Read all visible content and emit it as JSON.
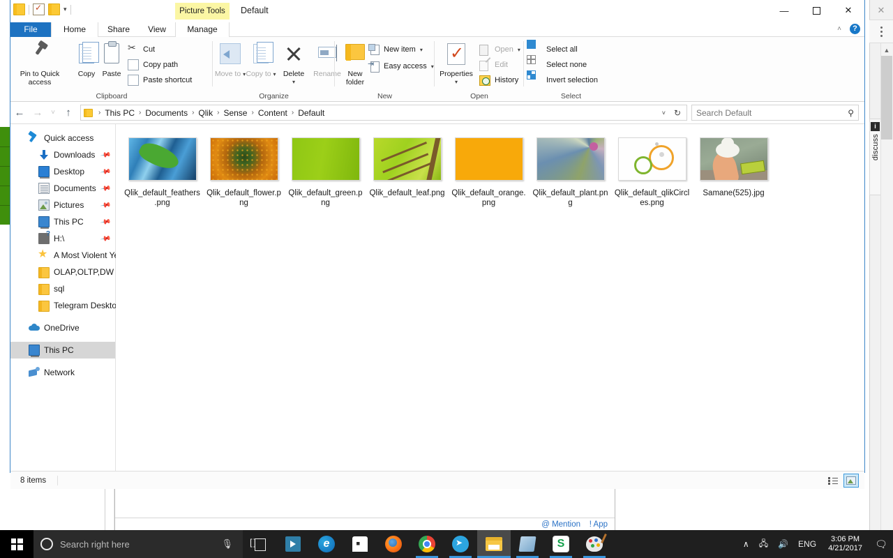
{
  "window": {
    "title": "Default",
    "contextual_tab_group": "Picture Tools",
    "quick_access": [
      "folder-icon",
      "properties-check-icon",
      "folder-icon",
      "dropdown-caret"
    ],
    "controls": {
      "minimize": "—",
      "maximize": "☐",
      "close": "✕"
    },
    "ribbon_collapse": "˄",
    "help": "?"
  },
  "tabs": [
    {
      "label": "File",
      "active": false,
      "highlight": true
    },
    {
      "label": "Home",
      "active": true
    },
    {
      "label": "Share",
      "active": false
    },
    {
      "label": "View",
      "active": false
    },
    {
      "label": "Manage",
      "active": false
    }
  ],
  "ribbon": {
    "groups": [
      {
        "name": "Clipboard",
        "big_buttons": [
          {
            "label": "Pin to Quick access",
            "icon": "pin-icon",
            "dim": false
          },
          {
            "label": "Copy",
            "icon": "copy-icon",
            "dim": false
          },
          {
            "label": "Paste",
            "icon": "paste-icon",
            "dim": false
          }
        ],
        "small_buttons": [
          {
            "label": "Cut",
            "icon": "scissors-icon",
            "dim": false
          },
          {
            "label": "Copy path",
            "icon": "copy-path-icon",
            "dim": false
          },
          {
            "label": "Paste shortcut",
            "icon": "paste-shortcut-icon",
            "dim": false
          }
        ]
      },
      {
        "name": "Organize",
        "big_buttons": [
          {
            "label": "Move to",
            "icon": "move-to-icon",
            "dim": true,
            "caret": true
          },
          {
            "label": "Copy to",
            "icon": "copy-to-icon",
            "dim": true,
            "caret": true
          },
          {
            "label": "Delete",
            "icon": "delete-x-icon",
            "dim": false,
            "caret": true
          },
          {
            "label": "Rename",
            "icon": "rename-icon",
            "dim": true
          }
        ],
        "small_buttons": []
      },
      {
        "name": "New",
        "big_buttons": [
          {
            "label": "New folder",
            "icon": "new-folder-icon",
            "dim": false
          }
        ],
        "small_buttons": [
          {
            "label": "New item",
            "icon": "new-item-icon",
            "dim": false,
            "caret": true
          },
          {
            "label": "Easy access",
            "icon": "easy-access-icon",
            "dim": false,
            "caret": true
          }
        ]
      },
      {
        "name": "Open",
        "big_buttons": [
          {
            "label": "Properties",
            "icon": "properties-icon",
            "dim": false,
            "caret": true
          }
        ],
        "small_buttons": [
          {
            "label": "Open",
            "icon": "open-icon",
            "dim": true,
            "caret": true
          },
          {
            "label": "Edit",
            "icon": "edit-icon",
            "dim": true
          },
          {
            "label": "History",
            "icon": "history-icon",
            "dim": false
          }
        ]
      },
      {
        "name": "Select",
        "big_buttons": [],
        "small_buttons": [
          {
            "label": "Select all",
            "icon": "select-all-icon",
            "dim": false
          },
          {
            "label": "Select none",
            "icon": "select-none-icon",
            "dim": false
          },
          {
            "label": "Invert selection",
            "icon": "invert-selection-icon",
            "dim": false
          }
        ]
      }
    ]
  },
  "address": {
    "back": "←",
    "forward": "→",
    "recent": "˅",
    "up": "↑",
    "breadcrumbs": [
      "This PC",
      "Documents",
      "Qlik",
      "Sense",
      "Content",
      "Default"
    ],
    "separator": "›",
    "dropdown": "˅",
    "refresh": "↻"
  },
  "search": {
    "placeholder": "Search Default",
    "value": "",
    "icon": "search-icon"
  },
  "sidebar": {
    "items": [
      {
        "label": "Quick access",
        "icon": "quick-access-star-icon",
        "level": 1,
        "pinned": false,
        "selected": false
      },
      {
        "label": "Downloads",
        "icon": "downloads-icon",
        "level": 2,
        "pinned": true,
        "selected": false
      },
      {
        "label": "Desktop",
        "icon": "desktop-icon",
        "level": 2,
        "pinned": true,
        "selected": false
      },
      {
        "label": "Documents",
        "icon": "documents-icon",
        "level": 2,
        "pinned": true,
        "selected": false
      },
      {
        "label": "Pictures",
        "icon": "pictures-icon",
        "level": 2,
        "pinned": true,
        "selected": false
      },
      {
        "label": "This PC",
        "icon": "this-pc-icon",
        "level": 2,
        "pinned": true,
        "selected": false
      },
      {
        "label": "H:\\",
        "icon": "drive-icon",
        "level": 2,
        "pinned": true,
        "selected": false
      },
      {
        "label": "A Most Violent Year",
        "icon": "star-folder-icon",
        "level": 2,
        "pinned": false,
        "selected": false
      },
      {
        "label": "OLAP,OLTP,DW",
        "icon": "folder-icon",
        "level": 2,
        "pinned": false,
        "selected": false
      },
      {
        "label": "sql",
        "icon": "folder-icon",
        "level": 2,
        "pinned": false,
        "selected": false
      },
      {
        "label": "Telegram Desktop",
        "icon": "folder-icon",
        "level": 2,
        "pinned": false,
        "selected": false
      },
      {
        "label": "OneDrive",
        "icon": "onedrive-icon",
        "level": 1,
        "pinned": false,
        "selected": false
      },
      {
        "label": "This PC",
        "icon": "this-pc-icon",
        "level": 1,
        "pinned": false,
        "selected": true
      },
      {
        "label": "Network",
        "icon": "network-icon",
        "level": 1,
        "pinned": false,
        "selected": false
      }
    ]
  },
  "files": [
    {
      "name": "Qlik_default_feathers.png",
      "art": "t-feathers"
    },
    {
      "name": "Qlik_default_flower.png",
      "art": "t-flower"
    },
    {
      "name": "Qlik_default_green.png",
      "art": "t-green"
    },
    {
      "name": "Qlik_default_leaf.png",
      "art": "t-leaf"
    },
    {
      "name": "Qlik_default_orange.png",
      "art": "t-orange"
    },
    {
      "name": "Qlik_default_plant.png",
      "art": "t-plant"
    },
    {
      "name": "Qlik_default_qlikCircles.png",
      "art": "t-circles"
    },
    {
      "name": "Samane(525).jpg",
      "art": "t-samane"
    }
  ],
  "status": {
    "item_count": "8 items",
    "view_details": "details-view-icon",
    "view_thumbnails": "thumbnails-view-icon"
  },
  "background_window": {
    "mention_link": "@ Mention",
    "app_link": "! App"
  },
  "discuss_panel": {
    "badge": "i",
    "label": "discuss",
    "close": "✕"
  },
  "taskbar": {
    "start": "windows-logo-icon",
    "search_placeholder": "Search right here",
    "cortana": "cortana-circle-icon",
    "mic": "microphone-icon",
    "task_view": "task-view-icon",
    "pinned_apps": [
      {
        "name": "movies-tv-icon",
        "running": false
      },
      {
        "name": "microsoft-edge-icon",
        "running": false
      },
      {
        "name": "microsoft-store-icon",
        "running": false
      },
      {
        "name": "firefox-icon",
        "running": false
      },
      {
        "name": "google-chrome-icon",
        "running": true
      },
      {
        "name": "telegram-icon",
        "running": true
      },
      {
        "name": "file-explorer-icon",
        "running": true,
        "active": true
      },
      {
        "name": "onenote-icon",
        "running": true
      },
      {
        "name": "skype-icon",
        "running": true
      },
      {
        "name": "paint-icon",
        "running": true
      }
    ],
    "tray": {
      "chevron": "∧",
      "network": "network-tray-icon",
      "volume": "volume-tray-icon",
      "language": "ENG",
      "time": "3:06 PM",
      "date": "4/21/2017",
      "notifications": "action-center-icon"
    }
  }
}
